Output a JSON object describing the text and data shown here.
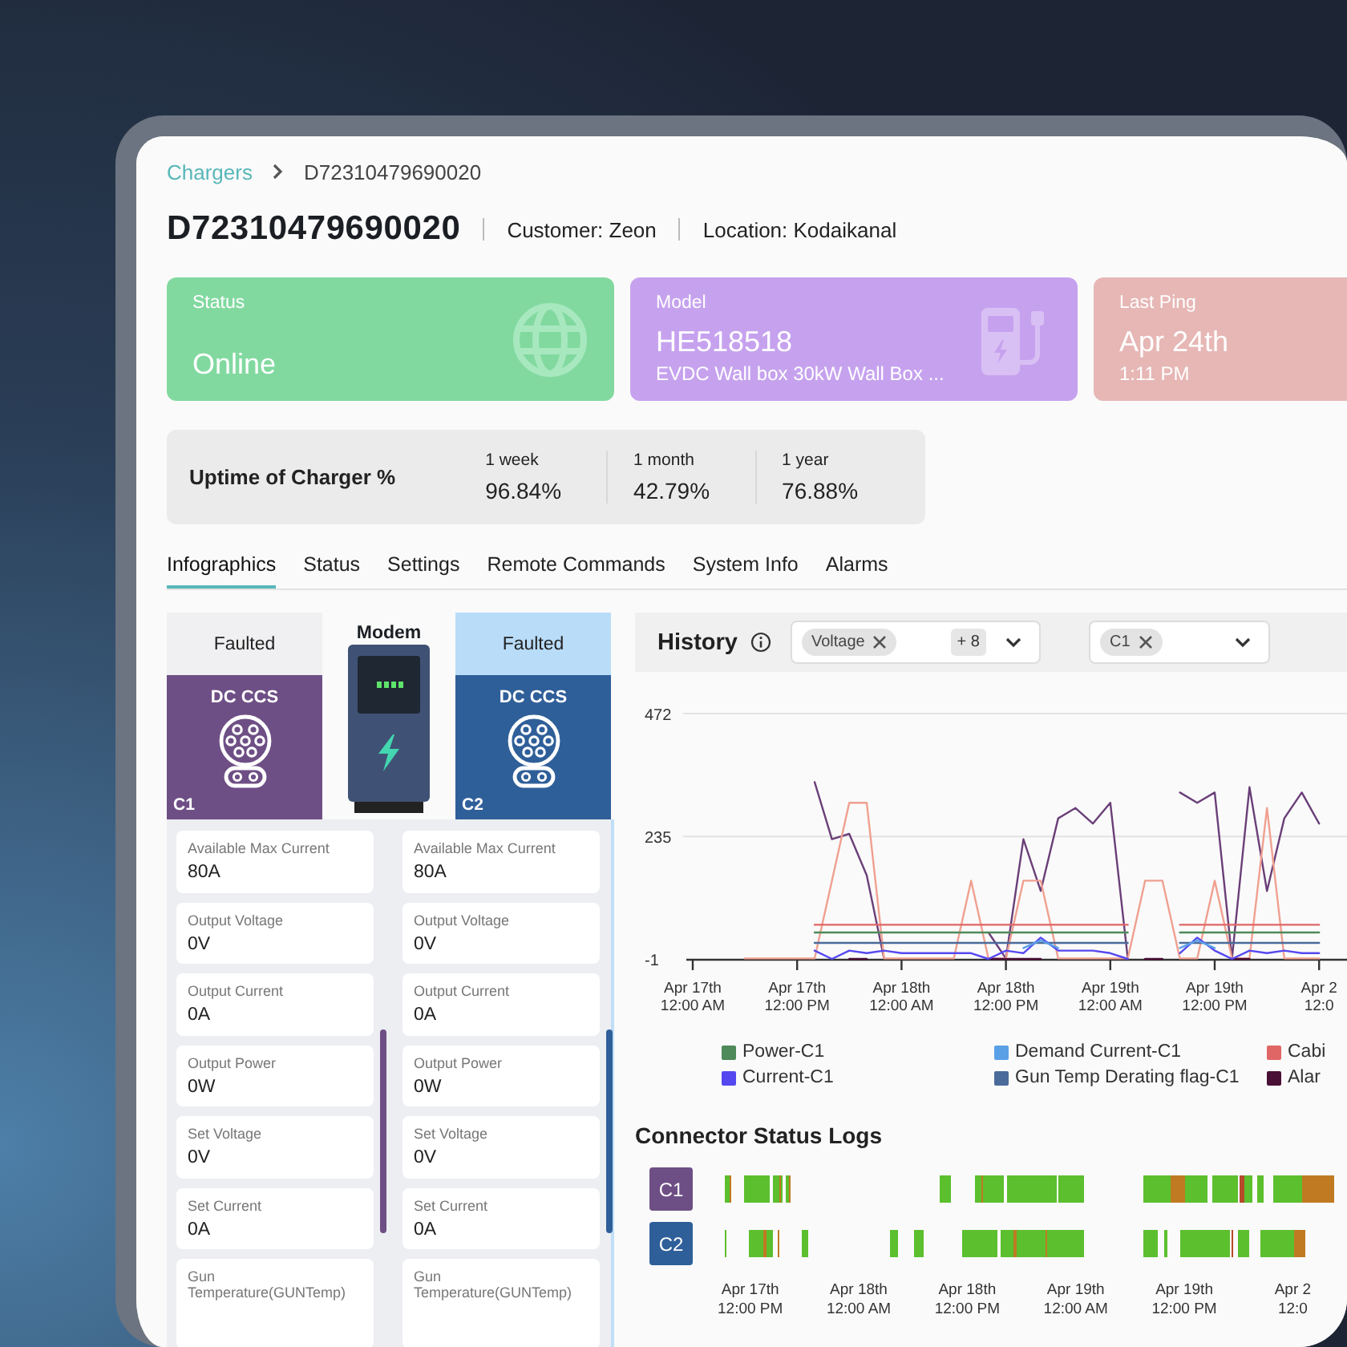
{
  "breadcrumb": {
    "parent": "Chargers",
    "current": "D72310479690020"
  },
  "header": {
    "title": "D72310479690020",
    "customer": "Customer: Zeon",
    "location": "Location: Kodaikanal"
  },
  "cards": [
    {
      "kind": "status",
      "label": "Status",
      "value": "Online",
      "color": "#82d9a0"
    },
    {
      "kind": "model",
      "label": "Model",
      "value": "HE518518",
      "detail": "EVDC Wall box 30kW Wall Box ...",
      "color": "#c6a2ee"
    },
    {
      "kind": "ping",
      "label": "Last Ping",
      "value": "Apr 24th",
      "detail": "1:11 PM",
      "color": "#e6b7b5"
    }
  ],
  "uptime": {
    "label": "Uptime of Charger %",
    "periods": [
      {
        "label": "1 week",
        "value": "96.84%"
      },
      {
        "label": "1 month",
        "value": "42.79%"
      },
      {
        "label": "1 year",
        "value": "76.88%"
      }
    ]
  },
  "tabs": [
    {
      "label": "Infographics",
      "selected": true
    },
    {
      "label": "Status",
      "selected": false
    },
    {
      "label": "Settings",
      "selected": false
    },
    {
      "label": "Remote Commands",
      "selected": false
    },
    {
      "label": "System Info",
      "selected": false
    },
    {
      "label": "Alarms",
      "selected": false
    }
  ],
  "infographics": {
    "modem": {
      "label": "Modem"
    },
    "connectors": [
      {
        "id": "C1",
        "status": "Faulted",
        "type": "DC CCS",
        "selected": false,
        "color": "#6e4f85",
        "items": [
          {
            "label": "Available Max Current",
            "value": "80A"
          },
          {
            "label": "Output Voltage",
            "value": "0V"
          },
          {
            "label": "Output Current",
            "value": "0A"
          },
          {
            "label": "Output Power",
            "value": "0W"
          },
          {
            "label": "Set Voltage",
            "value": "0V"
          },
          {
            "label": "Set Current",
            "value": "0A"
          },
          {
            "label": "Gun Temperature(GUNTemp)"
          }
        ]
      },
      {
        "id": "C2",
        "status": "Faulted",
        "type": "DC CCS",
        "selected": true,
        "color": "#2f5f99",
        "items": [
          {
            "label": "Available Max Current",
            "value": "80A"
          },
          {
            "label": "Output Voltage",
            "value": "0V"
          },
          {
            "label": "Output Current",
            "value": "0A"
          },
          {
            "label": "Output Power",
            "value": "0W"
          },
          {
            "label": "Set Voltage",
            "value": "0V"
          },
          {
            "label": "Set Current",
            "value": "0A"
          },
          {
            "label": "Gun Temperature(GUNTemp)"
          }
        ]
      }
    ]
  },
  "history": {
    "title": "History",
    "parameter_select": {
      "chip": "Voltage",
      "more": "+ 8"
    },
    "connector_select": {
      "chip": "C1"
    },
    "chart_data": {
      "type": "line",
      "categories": [
        "Apr 17th\n12:00 AM",
        null,
        null,
        null,
        null,
        null,
        "Apr 17th\n12:00 PM",
        null,
        null,
        null,
        null,
        null,
        "Apr 18th\n12:00 AM",
        null,
        null,
        null,
        null,
        null,
        "Apr 18th\n12:00 PM",
        null,
        null,
        null,
        null,
        null,
        "Apr 19th\n12:00 AM",
        null,
        null,
        null,
        null,
        null,
        "Apr 19th\n12:00 PM",
        null,
        null,
        null,
        null,
        null,
        "Apr 2\n12:0"
      ],
      "yticks": [
        -1,
        235,
        472
      ],
      "ylim": [
        -1,
        472
      ],
      "series": [
        {
          "name": "Power-C1",
          "color": "#4e8a5a",
          "values": [
            null,
            null,
            null,
            null,
            null,
            null,
            null,
            50,
            50,
            50,
            50,
            50,
            50,
            50,
            50,
            50,
            50,
            50,
            50,
            50,
            50,
            50,
            50,
            50,
            50,
            50,
            null,
            null,
            50,
            50,
            50,
            50,
            50,
            50,
            50,
            50,
            50
          ]
        },
        {
          "name": "Demand Current-C1",
          "color": "#5aa0e6",
          "values": [
            null,
            null,
            null,
            null,
            null,
            null,
            null,
            null,
            null,
            null,
            null,
            null,
            null,
            null,
            null,
            null,
            null,
            null,
            null,
            20,
            35,
            20,
            null,
            null,
            null,
            null,
            null,
            null,
            20,
            35,
            20,
            null,
            null,
            null,
            null,
            null,
            null
          ]
        },
        {
          "name": "Cabi",
          "color": "#e06666",
          "values": [
            null,
            null,
            null,
            null,
            null,
            null,
            null,
            65,
            65,
            65,
            65,
            65,
            65,
            65,
            65,
            65,
            65,
            65,
            65,
            65,
            65,
            65,
            65,
            65,
            65,
            65,
            null,
            null,
            65,
            65,
            65,
            65,
            65,
            65,
            65,
            65,
            65
          ]
        },
        {
          "name": "Current-C1",
          "color": "#5548f0",
          "values": [
            null,
            null,
            null,
            null,
            null,
            null,
            null,
            15,
            -1,
            15,
            10,
            15,
            10,
            10,
            10,
            10,
            10,
            -1,
            15,
            10,
            40,
            15,
            15,
            15,
            10,
            -1,
            null,
            null,
            10,
            40,
            15,
            -1,
            15,
            10,
            15,
            10,
            10
          ]
        },
        {
          "name": "Gun Temp Derating flag-C1",
          "color": "#4a6a9a",
          "values": [
            null,
            null,
            null,
            null,
            null,
            null,
            null,
            30,
            30,
            30,
            30,
            30,
            30,
            30,
            30,
            30,
            30,
            30,
            30,
            30,
            30,
            30,
            30,
            30,
            30,
            30,
            null,
            null,
            30,
            30,
            30,
            30,
            30,
            30,
            30,
            30,
            30
          ]
        },
        {
          "name": "Alar",
          "color": "#4a0f35",
          "values": [
            null,
            null,
            null,
            null,
            null,
            null,
            null,
            null,
            null,
            -1,
            -1,
            null,
            null,
            null,
            null,
            null,
            null,
            -1,
            -1,
            -1,
            -1,
            null,
            null,
            null,
            null,
            null,
            -1,
            -1,
            null,
            null,
            null,
            -1,
            -1,
            null,
            null,
            null,
            null
          ]
        },
        {
          "color": "#f0a090",
          "values": [
            null,
            null,
            null,
            0,
            0,
            0,
            0,
            0,
            150,
            300,
            300,
            0,
            0,
            0,
            0,
            0,
            150,
            0,
            0,
            150,
            150,
            0,
            0,
            0,
            0,
            0,
            150,
            150,
            0,
            0,
            150,
            0,
            0,
            290,
            0,
            0,
            0
          ]
        },
        {
          "color": "#6a3f78",
          "values": [
            null,
            null,
            null,
            null,
            null,
            null,
            null,
            340,
            230,
            240,
            160,
            0,
            null,
            null,
            null,
            null,
            null,
            50,
            0,
            230,
            130,
            270,
            290,
            260,
            300,
            0,
            null,
            null,
            320,
            300,
            320,
            0,
            330,
            130,
            270,
            320,
            260
          ]
        }
      ]
    }
  },
  "status_logs": {
    "title": "Connector Status Logs",
    "rows": [
      {
        "label": "C1",
        "color": "#6e4f85"
      },
      {
        "label": "C2",
        "color": "#2f5f99"
      }
    ],
    "ticks": [
      {
        "date": "Apr 17th",
        "time": "12:00 PM"
      },
      {
        "date": "Apr 18th",
        "time": "12:00 AM"
      },
      {
        "date": "Apr 18th",
        "time": "12:00 PM"
      },
      {
        "date": "Apr 19th",
        "time": "12:00 AM"
      },
      {
        "date": "Apr 19th",
        "time": "12:00 PM"
      },
      {
        "date": "Apr 2",
        "time": "12:0"
      }
    ]
  }
}
